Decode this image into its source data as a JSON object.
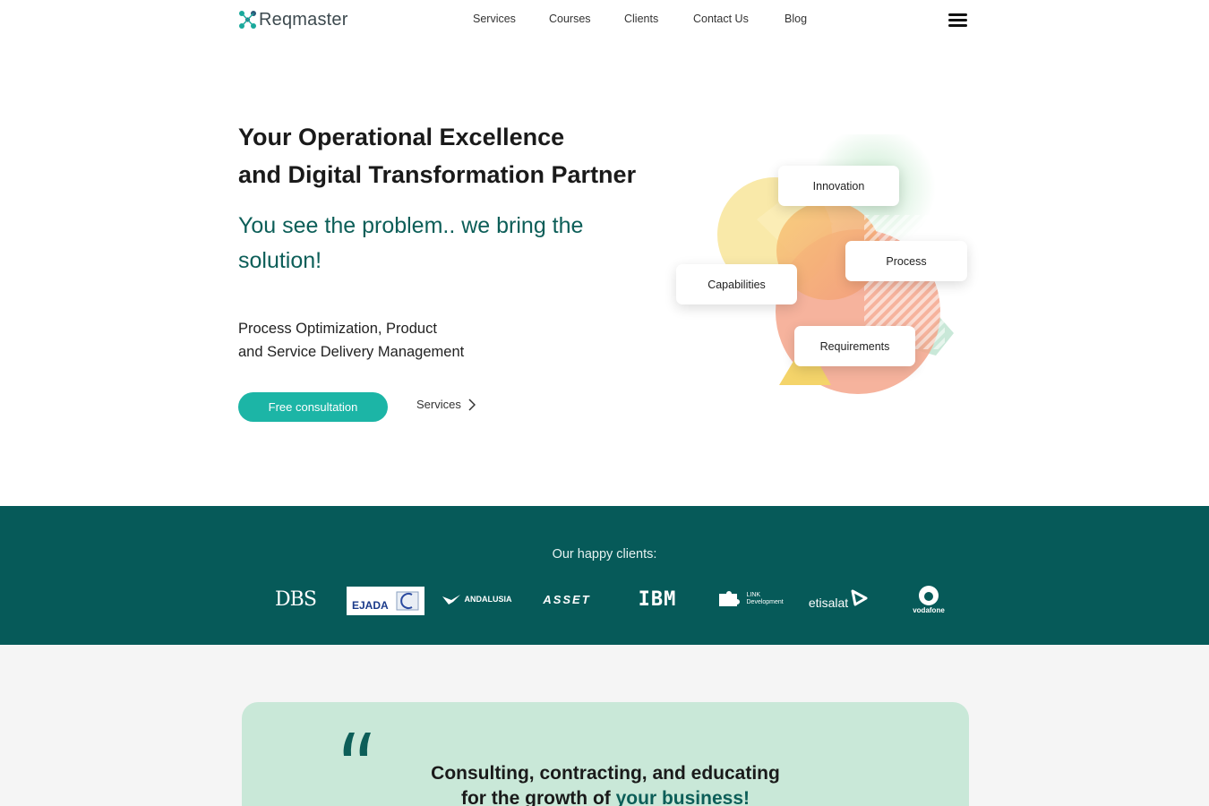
{
  "header": {
    "logo_text": "Reqmaster",
    "nav": [
      "Services",
      "Courses",
      "Clients",
      "Contact Us",
      "Blog"
    ],
    "menu_icon": "hamburger-menu-icon"
  },
  "hero": {
    "title_line1": "Your Operational Excellence",
    "title_line2": "and Digital Transformation Partner",
    "subtitle": "You see the problem.. we bring the solution!",
    "desc_line1": "Process Optimization, Product",
    "desc_line2": "and Service Delivery Management",
    "cta_label": "Free consultation",
    "services_link": "Services"
  },
  "illustration": {
    "cards": [
      "Innovation",
      "Process",
      "Capabilities",
      "Requirements"
    ]
  },
  "clients": {
    "title": "Our happy clients:",
    "logos": [
      "DBS",
      "EJADA",
      "ANDALUSIA",
      "ASSET",
      "IBM",
      "LINK Development",
      "etisalat",
      "vodafone"
    ]
  },
  "quote": {
    "line1": "Consulting, contracting, and educating",
    "line2_prefix": "for the growth of ",
    "line2_highlight": "your business!"
  },
  "colors": {
    "brand_teal": "#1cb5a6",
    "dark_teal": "#065a59",
    "mint": "#c9e8d8"
  }
}
